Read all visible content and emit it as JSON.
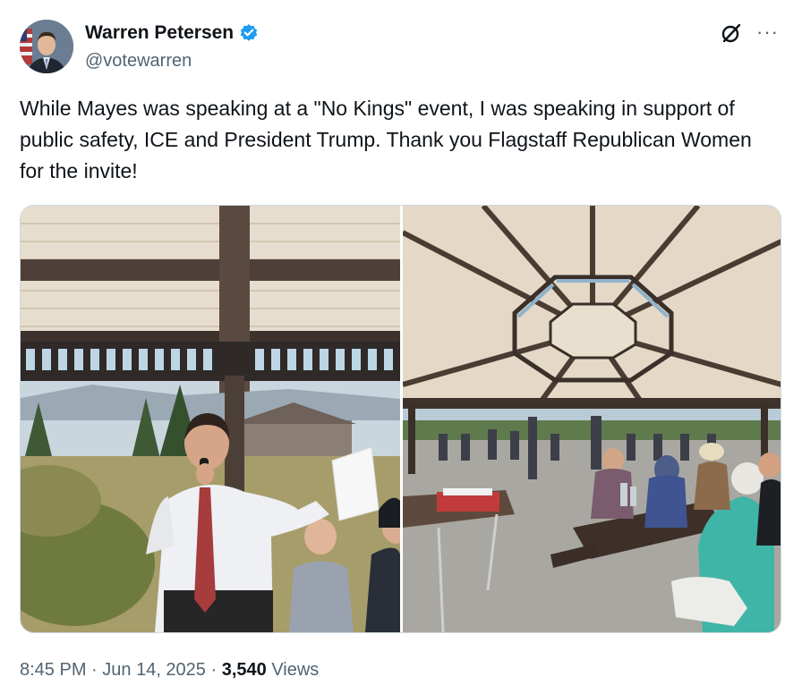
{
  "author": {
    "display_name": "Warren Petersen",
    "handle": "@votewarren",
    "verified": true,
    "avatar_icon": "profile-photo"
  },
  "header_actions": {
    "grok_icon": "grok-icon",
    "more_icon": "more-horizontal-icon",
    "more_glyph": "···"
  },
  "tweet": {
    "text": "While Mayes was speaking at a \"No Kings\" event,  I was speaking in support of public safety, ICE and President Trump.  Thank you Flagstaff Republican Women for the invite!"
  },
  "media": {
    "count": 2,
    "photos": [
      {
        "subject": "speaker-at-microphone-photo"
      },
      {
        "subject": "pavilion-audience-photo"
      }
    ]
  },
  "meta": {
    "time": "8:45 PM",
    "sep1": " · ",
    "date": "Jun 14, 2025",
    "sep2": " · ",
    "views_count": "3,540",
    "views_label": " Views"
  },
  "colors": {
    "verified_blue": "#1d9bf0",
    "text_primary": "#0f1419",
    "text_secondary": "#536471",
    "border": "#cfd9de"
  }
}
